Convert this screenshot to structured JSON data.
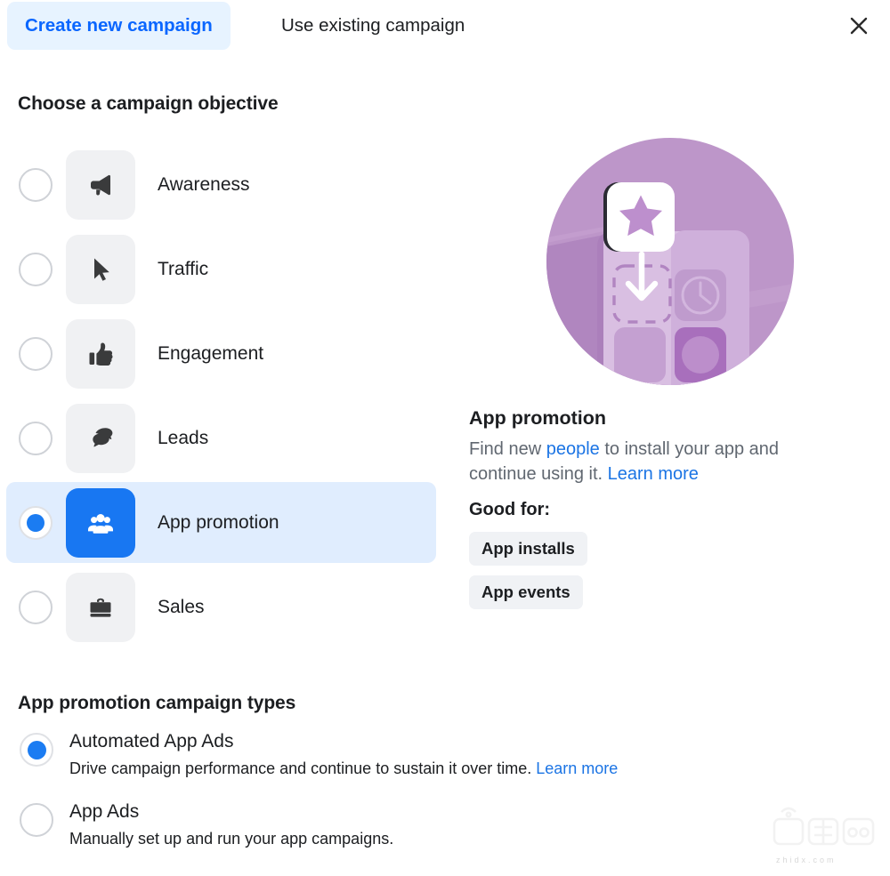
{
  "header": {
    "tabs": [
      {
        "id": "create-new",
        "label": "Create new campaign",
        "active": true
      },
      {
        "id": "use-existing",
        "label": "Use existing campaign",
        "active": false
      }
    ],
    "close_icon": "close-icon",
    "active_tab_bg": "#e7f3ff",
    "active_tab_color": "#0a66ff"
  },
  "objective": {
    "title": "Choose a campaign objective",
    "selected": "App promotion",
    "items": [
      {
        "label": "Awareness",
        "icon": "megaphone-icon",
        "selected": false
      },
      {
        "label": "Traffic",
        "icon": "cursor-icon",
        "selected": false
      },
      {
        "label": "Engagement",
        "icon": "thumbs-up-icon",
        "selected": false
      },
      {
        "label": "Leads",
        "icon": "chat-bubbles-icon",
        "selected": false
      },
      {
        "label": "App promotion",
        "icon": "people-group-icon",
        "selected": true
      },
      {
        "label": "Sales",
        "icon": "briefcase-icon",
        "selected": false
      }
    ],
    "selected_row_bg": "#e0edfe",
    "selected_tile_bg": "#1877f2",
    "radio_accent": "#1b7cf2"
  },
  "detail": {
    "illustration": "app-promotion-illustration",
    "title": "App promotion",
    "desc_part1": "Find new ",
    "desc_link1": "people",
    "desc_part2": " to install your app and continue using it. ",
    "desc_link2": "Learn more",
    "good_for_label": "Good for:",
    "tags": [
      "App installs",
      "App events"
    ],
    "link_color": "#1b74e4"
  },
  "campaign_types": {
    "title": "App promotion campaign types",
    "items": [
      {
        "name": "Automated App Ads",
        "desc": "Drive campaign performance and continue to sustain it over time. ",
        "desc_link": "Learn more",
        "selected": true
      },
      {
        "name": "App Ads",
        "desc": "Manually set up and run your app campaigns.",
        "desc_link": "",
        "selected": false
      }
    ]
  },
  "watermark": {
    "text": "zhidx.com"
  }
}
